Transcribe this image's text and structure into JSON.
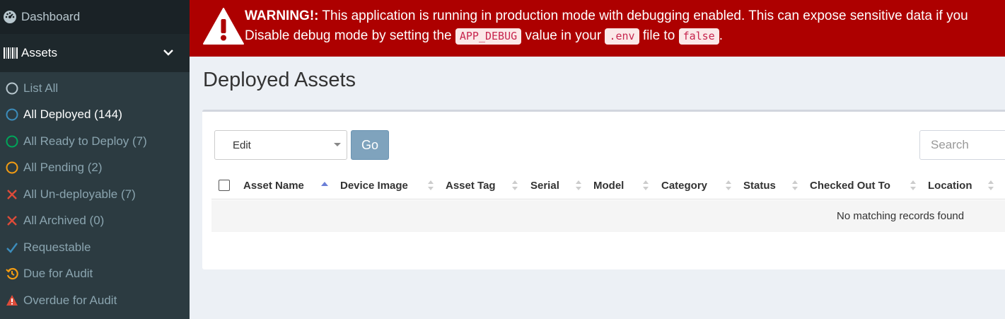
{
  "sidebar": {
    "dashboard_label": "Dashboard",
    "assets_label": "Assets",
    "items": [
      {
        "label": "List All",
        "icon": "circle-outline-icon",
        "color": "#b8c7ce"
      },
      {
        "label": "All Deployed (144)",
        "icon": "circle-outline-icon",
        "color": "#3c8dbc",
        "active": true
      },
      {
        "label": "All Ready to Deploy (7)",
        "icon": "circle-outline-icon",
        "color": "#00a65a"
      },
      {
        "label": "All Pending (2)",
        "icon": "circle-outline-icon",
        "color": "#f39c12"
      },
      {
        "label": "All Un-deployable (7)",
        "icon": "x-icon",
        "color": "#dd4b39"
      },
      {
        "label": "All Archived (0)",
        "icon": "x-icon",
        "color": "#dd4b39"
      },
      {
        "label": "Requestable",
        "icon": "check-icon",
        "color": "#3c8dbc"
      },
      {
        "label": "Due for Audit",
        "icon": "history-icon",
        "color": "#f39c12"
      },
      {
        "label": "Overdue for Audit",
        "icon": "warning-icon",
        "color": "#dd4b39"
      }
    ]
  },
  "warning": {
    "heading": "WARNING!:",
    "line1": "This application is running in production mode with debugging enabled. This can expose sensitive data if you",
    "line2_a": "Disable debug mode by setting the",
    "code1": "APP_DEBUG",
    "line2_b": "value in your",
    "code2": ".env",
    "line2_c": "file to",
    "code3": "false",
    "line2_d": ".",
    "bg_color": "#ad0000"
  },
  "page": {
    "title": "Deployed Assets"
  },
  "toolbar": {
    "bulk_action_value": "Edit",
    "go_label": "Go",
    "search_placeholder": "Search"
  },
  "table": {
    "columns": [
      "Asset Name",
      "Device Image",
      "Asset Tag",
      "Serial",
      "Model",
      "Category",
      "Status",
      "Checked Out To",
      "Location"
    ],
    "empty_message": "No matching records found"
  }
}
